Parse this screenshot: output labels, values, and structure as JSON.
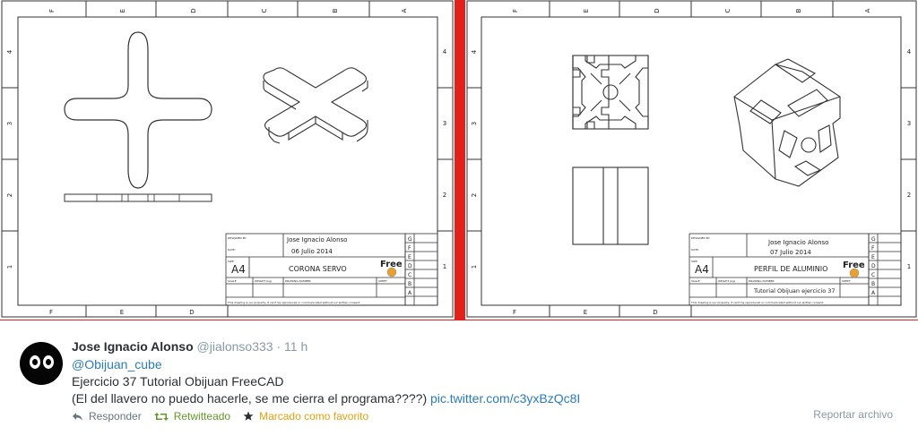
{
  "drawings": {
    "column_letters": [
      "F",
      "E",
      "D",
      "C",
      "B",
      "A"
    ],
    "row_numbers": [
      "4",
      "3",
      "2",
      "1"
    ],
    "left": {
      "designer": "Jose Ignacio Alonso",
      "date": "06  Julio  2014",
      "size": "A4",
      "title": "CORONA  SERVO",
      "drawing_number": "",
      "logo_text": "Free"
    },
    "right": {
      "designer": "Jose Ignacio Alonso",
      "date": "07  Julio  2014",
      "size": "A4",
      "title": "PERFIL  DE ALUMINIO",
      "drawing_number": "Tutorial Obijuan ejercicio 37",
      "logo_text": "Free"
    }
  },
  "tweet": {
    "name": "Jose Ignacio Alonso",
    "handle": "@jialonso333",
    "separator": "·",
    "time": "11 h",
    "mention": "@Obijuan_cube",
    "line2": "Ejercicio 37 Tutorial Obijuan FreeCAD",
    "line3": "(El del llavero no puedo hacerle, se me cierra el programa????)",
    "link": "pic.twitter.com/c3yxBzQc8I",
    "actions": {
      "reply": "Responder",
      "retweet": "Retwitteado",
      "favorite": "Marcado como favorito"
    },
    "report": "Reportar archivo"
  },
  "colors": {
    "divider_red": "#e3201b",
    "link_blue": "#2b7bb9",
    "retweet_green": "#609928",
    "favorite_gold": "#e1a10d"
  }
}
